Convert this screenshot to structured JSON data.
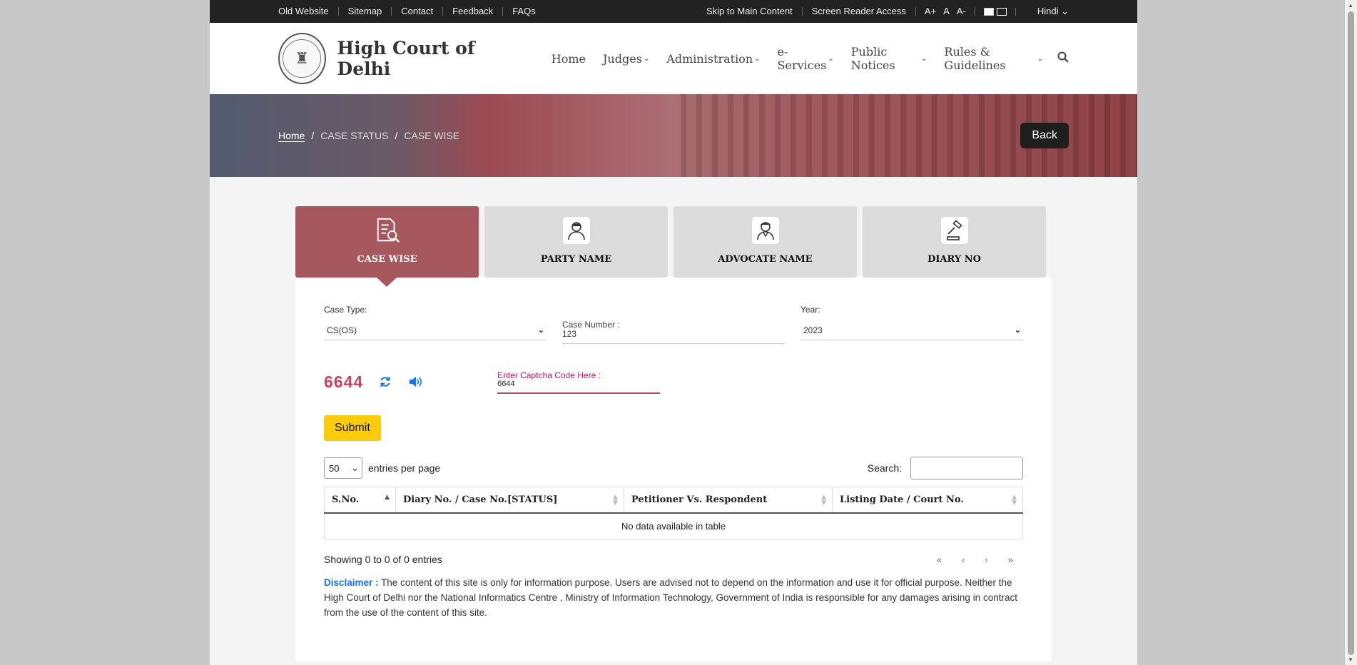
{
  "topbar": {
    "links": [
      "Old Website",
      "Sitemap",
      "Contact",
      "Feedback",
      "FAQs"
    ],
    "skip": "Skip to Main Content",
    "screen_reader": "Screen Reader Access",
    "font_sizes": [
      "A+",
      "A",
      "A-"
    ],
    "language": "Hindi"
  },
  "header": {
    "title": "High Court of Delhi",
    "nav": [
      "Home",
      "Judges",
      "Administration",
      "e-Services",
      "Public Notices",
      "Rules & Guidelines"
    ]
  },
  "banner": {
    "breadcrumb": [
      "Home",
      "CASE STATUS",
      "CASE WISE"
    ],
    "back_label": "Back"
  },
  "tabs": [
    "CASE WISE",
    "PARTY NAME",
    "ADVOCATE NAME",
    "DIARY NO"
  ],
  "form": {
    "case_type_label": "Case Type:",
    "case_type_value": "CS(OS)",
    "case_number_label": "Case Number :",
    "case_number_value": "123",
    "year_label": "Year:",
    "year_value": "2023",
    "captcha_code": "6644",
    "captcha_label": "Enter Captcha Code Here :",
    "captcha_value": "6644",
    "submit_label": "Submit"
  },
  "table": {
    "length_value": "50",
    "length_label": "entries per page",
    "search_label": "Search:",
    "columns": [
      "S.No.",
      "Diary No. / Case No.[STATUS]",
      "Petitioner Vs. Respondent",
      "Listing Date / Court No."
    ],
    "empty": "No data available in table",
    "info": "Showing 0 to 0 of 0 entries",
    "pager": [
      "«",
      "‹",
      "›",
      "»"
    ]
  },
  "disclaimer": {
    "label": "Disclaimer :",
    "text": " The content of this site is only for information purpose. Users are advised not to depend on the information and use it for official purpose. Neither the High Court of Delhi nor the National Informatics Centre , Ministry of Information Technology, Government of India is responsible for any damages arising in contract from the use of the content of this site."
  },
  "colors": {
    "accent": "#a7585f",
    "submit": "#fdcb0e",
    "captcha": "#d43d62",
    "link": "#1a73e8"
  }
}
